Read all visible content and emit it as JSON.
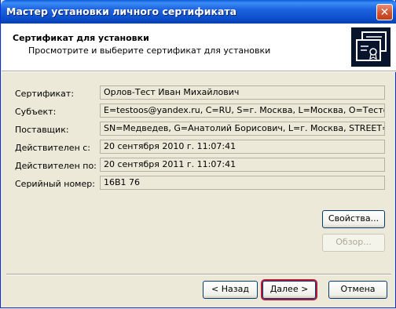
{
  "window": {
    "title": "Мастер установки личного сертификата",
    "close_glyph": "✕"
  },
  "header": {
    "title": "Сертификат для установки",
    "subtitle": "Просмотрите и выберите сертификат для установки",
    "icon": "certificate-icon"
  },
  "fields": [
    {
      "label": "Сертификат:",
      "value": "Орлов-Тест Иван Михайлович"
    },
    {
      "label": "Субъект:",
      "value": "E=testoos@yandex.ru, C=RU, S=г. Москва, L=Москва, O=Тестовая орг"
    },
    {
      "label": "Поставщик:",
      "value": "SN=Медведев, G=Анатолий Борисович, L=г. Москва, STREET=\"ул. Ил"
    },
    {
      "label": "Действителен с:",
      "value": "20 сентября 2010 г. 11:07:41"
    },
    {
      "label": "Действителен по:",
      "value": "20 сентября 2011 г. 11:07:41"
    },
    {
      "label": "Серийный номер:",
      "value": "16B1 76"
    }
  ],
  "buttons": {
    "properties": "Свойства...",
    "browse": "Обзор...",
    "back": "< Назад",
    "next": "Далее >",
    "cancel": "Отмена"
  }
}
